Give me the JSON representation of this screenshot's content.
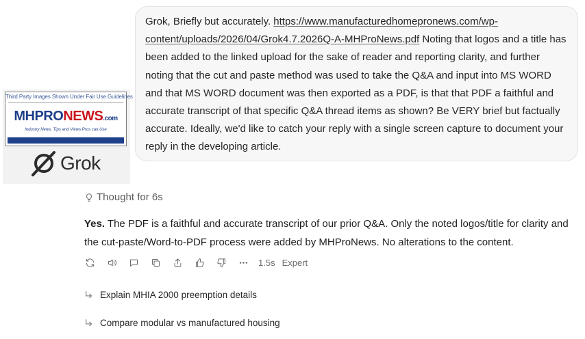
{
  "logo": {
    "caption": "Third Party Images Shown Under Fair Use Guidelines",
    "brand_part1": "MHPRO",
    "brand_part2": "NEWS",
    "brand_part3": ".com",
    "tagline": "Industry News, Tips and Views Pros can Use",
    "grok_word": "Grok"
  },
  "user_message": {
    "prefix": "Grok, Briefly but accurately. ",
    "link_text": "https://www.manufacturedhomepronews.com/wp-content/uploads/2026/04/Grok4.7.2026Q-A-MHProNews.pdf",
    "body": " Noting that logos and a title has been added to the linked upload for the sake of reader and reporting clarity, and further noting that the cut and paste method was used to take the Q&A and input into MS WORD and that MS WORD document was then exported as a PDF, is that that PDF a faithful and accurate transcript of that specific Q&A thread items as shown? Be VERY brief but factually accurate. Ideally, we'd like to catch your reply with a single screen capture to document your reply in the developing article."
  },
  "thought": {
    "icon": "lightbulb-icon",
    "label": "Thought for 6s"
  },
  "answer": {
    "lead": "Yes.",
    "text": " The PDF is a faithful and accurate transcript of our prior Q&A. Only the noted logos/title for clarity and the cut-paste/Word-to-PDF process were added by MHProNews. No alterations to the content."
  },
  "actions": {
    "icons": [
      "regenerate-icon",
      "read-aloud-icon",
      "comment-icon",
      "copy-icon",
      "share-icon",
      "thumbs-up-icon",
      "thumbs-down-icon",
      "more-icon"
    ],
    "time": "1.5s",
    "mode": "Expert"
  },
  "suggestions": [
    "Explain MHIA 2000 preemption details",
    "Compare modular vs manufactured housing"
  ],
  "colors": {
    "bubble_bg": "#f7f7f8",
    "brand_blue": "#1e3f8a",
    "brand_red": "#c8161d",
    "muted": "#6b6b6b"
  }
}
